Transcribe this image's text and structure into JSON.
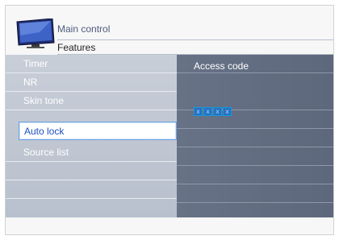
{
  "breadcrumb": {
    "level1": "Main control",
    "level2": "Features"
  },
  "menu": {
    "items": [
      {
        "label": "Timer"
      },
      {
        "label": "NR"
      },
      {
        "label": "Skin tone"
      },
      {
        "label": "Auto lock",
        "selected": true
      },
      {
        "label": "Source list"
      },
      {
        "label": ""
      },
      {
        "label": ""
      },
      {
        "label": ""
      }
    ]
  },
  "panel": {
    "title": "Access code",
    "code_digits": [
      "x",
      "x",
      "x",
      "x"
    ]
  },
  "colors": {
    "menu_bg": "#c0c7d3",
    "panel_bg": "#637087",
    "selection": "#6fa3e0",
    "code_box": "#0e9ae0"
  },
  "icons": {
    "header_icon": "tv-icon"
  }
}
